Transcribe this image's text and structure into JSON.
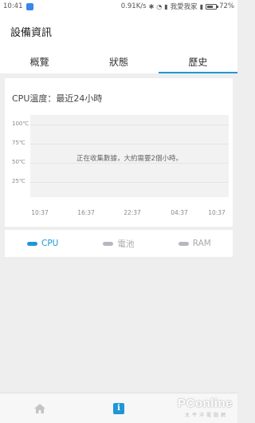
{
  "status_bar": {
    "time": "10:41",
    "speed": "0.91K/s",
    "carrier": "我愛我家",
    "battery": "72%",
    "battery_level": 0.72
  },
  "header": {
    "title": "設備資訊"
  },
  "tabs": [
    {
      "label": "概覽",
      "active": false
    },
    {
      "label": "狀態",
      "active": false
    },
    {
      "label": "歷史",
      "active": true
    }
  ],
  "chart_data": {
    "type": "line",
    "title": "CPU溫度：最近24小時",
    "y_ticks": [
      "100℃",
      "75℃",
      "50℃",
      "25℃"
    ],
    "x_ticks": [
      "10:37",
      "16:37",
      "22:37",
      "04:37",
      "10:37"
    ],
    "series": [],
    "message": "正在收集數據，大約需要2個小時。",
    "grid": true
  },
  "legend": [
    {
      "label": "CPU",
      "active": true,
      "color": "#2196d6"
    },
    {
      "label": "電池",
      "active": false,
      "color": "#b5b8bf"
    },
    {
      "label": "RAM",
      "active": false,
      "color": "#b5b8bf"
    }
  ],
  "bottom_nav": [
    {
      "icon": "home-icon"
    },
    {
      "icon": "info-icon",
      "glyph": "i"
    }
  ],
  "watermark": {
    "brand": "PConline",
    "sub": "太平洋電腦網"
  }
}
